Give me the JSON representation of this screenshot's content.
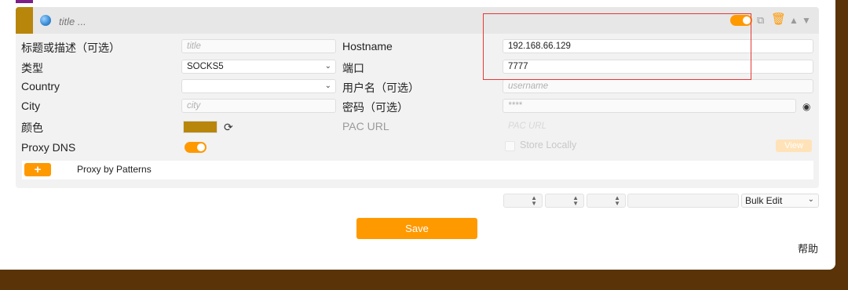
{
  "header": {
    "title_placeholder": "title ...",
    "icons": [
      "globe-icon",
      "toggle-switch",
      "copy-icon",
      "trash-icon",
      "move-up-icon",
      "move-down-icon"
    ]
  },
  "colors": {
    "accent": "#ff9900",
    "proxy_color": "#b8860b",
    "background": "#5a3408",
    "highlight_box": "#e53935"
  },
  "form": {
    "title_label": "标题或描述（可选）",
    "title_placeholder": "title",
    "type_label": "类型",
    "type_value": "SOCKS5",
    "country_label": "Country",
    "country_value": "",
    "city_label": "City",
    "city_placeholder": "city",
    "color_label": "颜色",
    "proxy_dns_label": "Proxy DNS",
    "hostname_label": "Hostname",
    "hostname_value": "192.168.66.129",
    "port_label": "端口",
    "port_value": "7777",
    "username_label": "用户名（可选）",
    "username_placeholder": "username",
    "password_label": "密码（可选）",
    "password_placeholder": "****",
    "pac_url_label": "PAC URL",
    "pac_url_placeholder": "PAC URL",
    "store_locally_label": "Store Locally",
    "view_label": "View"
  },
  "patterns": {
    "add_label": "+",
    "label": "Proxy by Patterns"
  },
  "footer": {
    "bulk_edit": "Bulk Edit",
    "save": "Save",
    "help": "帮助"
  }
}
